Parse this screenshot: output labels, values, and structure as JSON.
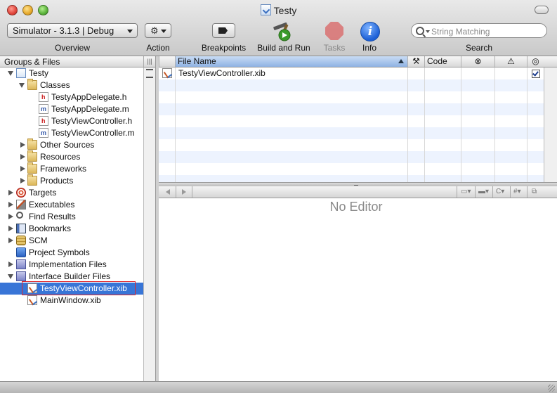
{
  "window": {
    "title": "Testy"
  },
  "toolbar": {
    "overview_value": "Simulator - 3.1.3 | Debug",
    "labels": {
      "overview": "Overview",
      "action": "Action",
      "breakpoints": "Breakpoints",
      "build_and_run": "Build and Run",
      "tasks": "Tasks",
      "info": "Info",
      "search": "Search"
    },
    "info_glyph": "i",
    "search_placeholder": "String Matching"
  },
  "sidebar": {
    "header": "Groups & Files",
    "items": [
      {
        "label": "Testy",
        "icon": "project-icon"
      },
      {
        "label": "Classes",
        "icon": "folder-icon"
      },
      {
        "label": "TestyAppDelegate.h",
        "icon": "header-file-icon"
      },
      {
        "label": "TestyAppDelegate.m",
        "icon": "source-file-icon"
      },
      {
        "label": "TestyViewController.h",
        "icon": "header-file-icon"
      },
      {
        "label": "TestyViewController.m",
        "icon": "source-file-icon"
      },
      {
        "label": "Other Sources",
        "icon": "folder-icon"
      },
      {
        "label": "Resources",
        "icon": "folder-icon"
      },
      {
        "label": "Frameworks",
        "icon": "folder-icon"
      },
      {
        "label": "Products",
        "icon": "folder-icon"
      },
      {
        "label": "Targets",
        "icon": "target-icon"
      },
      {
        "label": "Executables",
        "icon": "executable-icon"
      },
      {
        "label": "Find Results",
        "icon": "magnifier-icon"
      },
      {
        "label": "Bookmarks",
        "icon": "bookmark-icon"
      },
      {
        "label": "SCM",
        "icon": "scm-icon"
      },
      {
        "label": "Project Symbols",
        "icon": "symbols-icon"
      },
      {
        "label": "Implementation Files",
        "icon": "smart-group-icon"
      },
      {
        "label": "Interface Builder Files",
        "icon": "smart-group-icon"
      },
      {
        "label": "TestyViewController.xib",
        "icon": "xib-file-icon"
      },
      {
        "label": "MainWindow.xib",
        "icon": "xib-file-icon"
      }
    ]
  },
  "filelist": {
    "columns": {
      "file_name": "File Name",
      "code": "Code"
    },
    "rows": [
      {
        "name": "TestyViewController.xib",
        "checked": true
      }
    ]
  },
  "editor": {
    "empty_text": "No Editor",
    "popups": {
      "c": "C",
      "hash": "#"
    }
  },
  "colors": {
    "selection": "#3875d7",
    "selection_outline": "#e0262b",
    "alt_row": "#edf3fe"
  }
}
